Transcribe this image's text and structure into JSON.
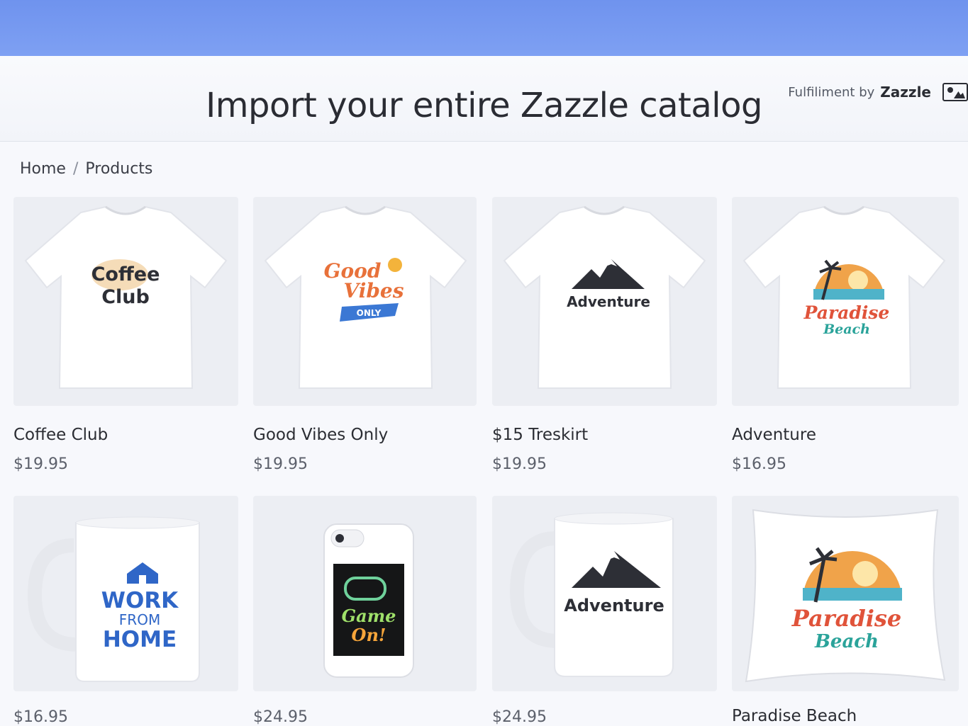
{
  "header": {
    "title": "Import your entire Zazzle catalog",
    "fulfilment_label": "Fulfiliment by",
    "brand": "Zazzle"
  },
  "breadcrumb": {
    "home": "Home",
    "separator": "/",
    "current": "Products"
  },
  "products": [
    {
      "name": "Coffee Club",
      "price": "$19.95",
      "kind": "tshirt",
      "art": [
        "Coffee",
        "Club"
      ]
    },
    {
      "name": "Good Vibes Only",
      "price": "$19.95",
      "kind": "tshirt",
      "art": [
        "Good",
        "Vibes",
        "ONLY"
      ]
    },
    {
      "name": "$15 Treskirt",
      "price": "$19.95",
      "kind": "tshirt",
      "art": [
        "Adventure"
      ]
    },
    {
      "name": "Adventure",
      "price": "$16.95",
      "kind": "tshirt",
      "art": [
        "Paradise",
        "Beach"
      ]
    },
    {
      "name": "",
      "price": "$16.95",
      "kind": "mug",
      "art": [
        "WORK",
        "FROM",
        "HOME"
      ]
    },
    {
      "name": "",
      "price": "$24.95",
      "kind": "phone-case",
      "art": [
        "Game",
        "On!"
      ]
    },
    {
      "name": "",
      "price": "$24.95",
      "kind": "mug",
      "art": [
        "Adventure"
      ]
    },
    {
      "name": "Paradise Beach",
      "price": "",
      "kind": "pillow",
      "art": [
        "Paradise",
        "Beach"
      ]
    }
  ],
  "colors": {
    "top_band": "#7a9cf2",
    "accent_blue": "#2f66c7",
    "orange": "#e8713a",
    "teal": "#2aa39a"
  }
}
